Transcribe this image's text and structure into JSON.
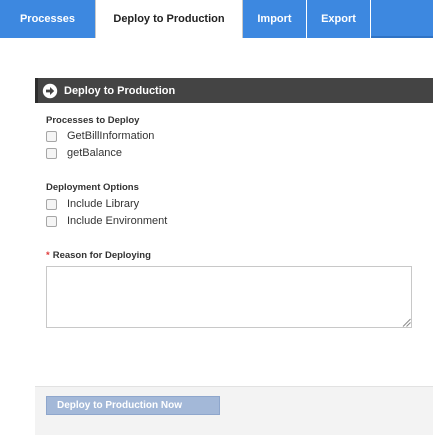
{
  "tabs": [
    {
      "label": "Processes",
      "active": false
    },
    {
      "label": "Deploy to Production",
      "active": true
    },
    {
      "label": "Import",
      "active": false
    },
    {
      "label": "Export",
      "active": false
    }
  ],
  "section": {
    "title": "Deploy to Production",
    "icon": "arrow-circle-right-icon"
  },
  "processes": {
    "label": "Processes to Deploy",
    "items": [
      "GetBillInformation",
      "getBalance"
    ]
  },
  "deployment_options": {
    "label": "Deployment Options",
    "items": [
      "Include Library",
      "Include Environment"
    ]
  },
  "reason": {
    "required_marker": "*",
    "label": "Reason for Deploying",
    "value": ""
  },
  "actions": {
    "deploy_now_label": "Deploy to Production Now"
  },
  "colors": {
    "tab_bar": "#3d88e0",
    "section_header": "#444444",
    "button": "#a3b8d8",
    "required": "#e03a3a"
  }
}
